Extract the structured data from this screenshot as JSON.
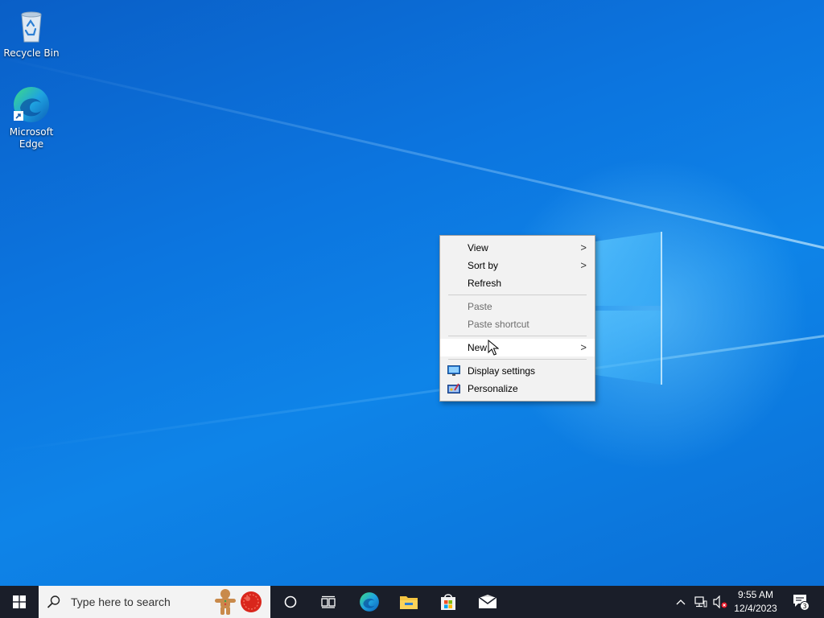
{
  "desktop": {
    "icons": [
      {
        "label": "Recycle Bin",
        "icon": "recycle-bin-icon"
      },
      {
        "label": "Microsoft Edge",
        "icon": "edge-icon"
      }
    ]
  },
  "context_menu": {
    "items": [
      {
        "label": "View",
        "has_submenu": true,
        "enabled": true
      },
      {
        "label": "Sort by",
        "has_submenu": true,
        "enabled": true
      },
      {
        "label": "Refresh",
        "has_submenu": false,
        "enabled": true
      },
      {
        "label": "Paste",
        "has_submenu": false,
        "enabled": false
      },
      {
        "label": "Paste shortcut",
        "has_submenu": false,
        "enabled": false
      },
      {
        "label": "New",
        "has_submenu": true,
        "enabled": true,
        "highlighted": true
      },
      {
        "label": "Display settings",
        "icon": "display-settings-icon",
        "enabled": true
      },
      {
        "label": "Personalize",
        "icon": "personalize-icon",
        "enabled": true
      }
    ],
    "submenu_arrow": ">"
  },
  "taskbar": {
    "search_placeholder": "Type here to search",
    "pinned": [
      "task-view-icon",
      "edge-icon",
      "file-explorer-icon",
      "store-icon",
      "mail-icon"
    ],
    "clock": {
      "time": "9:55 AM",
      "date": "12/4/2023"
    },
    "notification_count": "3"
  },
  "colors": {
    "desktop_bg": "#0c75df",
    "taskbar_bg": "#1a1e29",
    "menu_bg": "#f2f2f2",
    "menu_disabled_text": "#6d6d6d"
  }
}
